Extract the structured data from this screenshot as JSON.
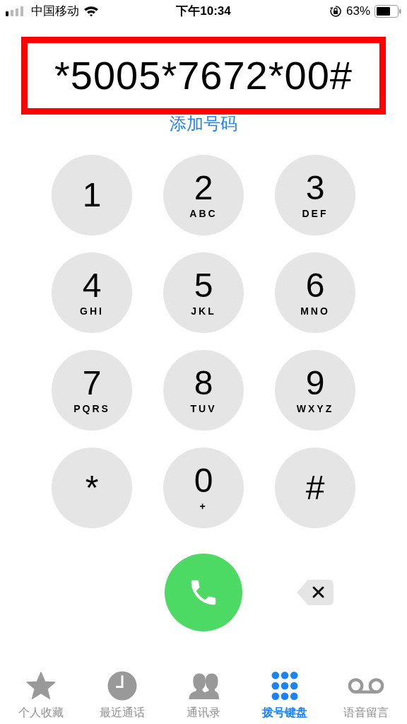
{
  "status_bar": {
    "carrier": "中国移动",
    "time": "下午10:34",
    "battery": "63%"
  },
  "dialed_number": "*5005*7672*00#",
  "add_number_link": "添加号码",
  "keypad": [
    {
      "digit": "1"
    },
    {
      "digit": "2",
      "letters": "ABC"
    },
    {
      "digit": "3",
      "letters": "DEF"
    },
    {
      "digit": "4",
      "letters": "GHI"
    },
    {
      "digit": "5",
      "letters": "JKL"
    },
    {
      "digit": "6",
      "letters": "MNO"
    },
    {
      "digit": "7",
      "letters": "PQRS"
    },
    {
      "digit": "8",
      "letters": "TUV"
    },
    {
      "digit": "9",
      "letters": "WXYZ"
    },
    {
      "digit": "*"
    },
    {
      "digit": "0",
      "letters": "+"
    },
    {
      "digit": "#"
    }
  ],
  "tabs": [
    {
      "kind": "favorites",
      "label": "个人收藏",
      "selected": false
    },
    {
      "kind": "recents",
      "label": "最近通话",
      "selected": false
    },
    {
      "kind": "contacts",
      "label": "通讯录",
      "selected": false
    },
    {
      "kind": "keypad",
      "label": "拨号键盘",
      "selected": true
    },
    {
      "kind": "voicemail",
      "label": "语音留言",
      "selected": false
    }
  ]
}
